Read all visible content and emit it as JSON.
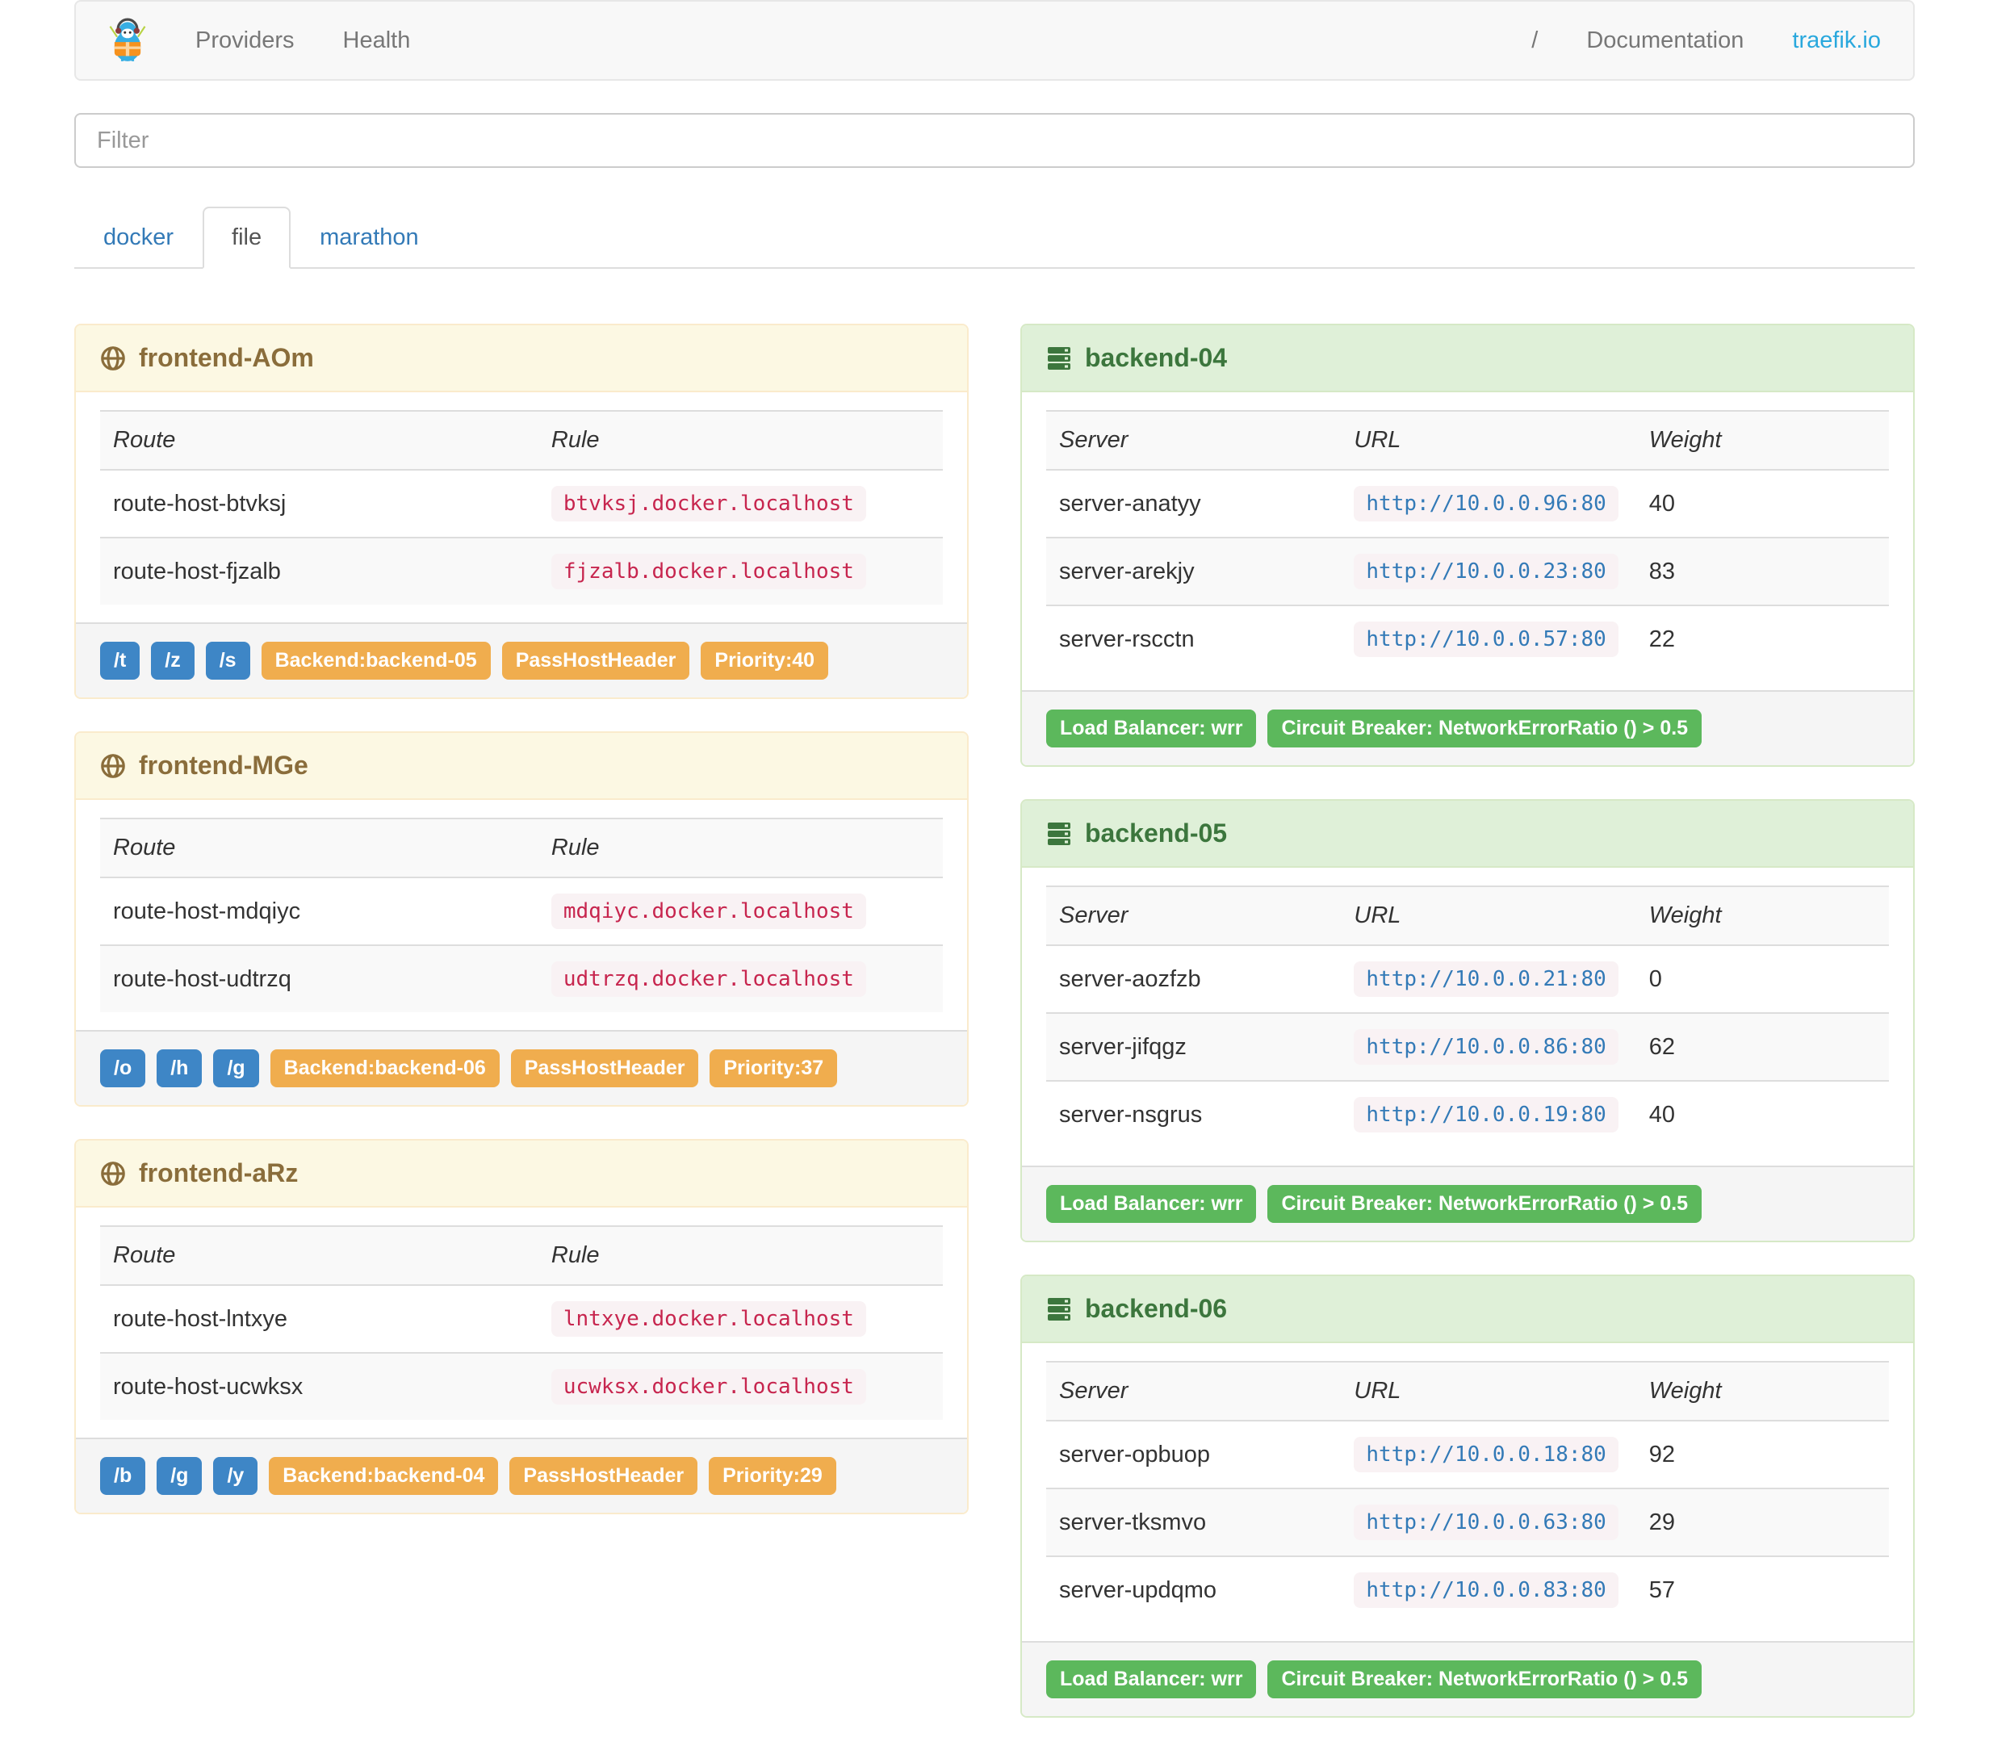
{
  "navbar": {
    "brand": "traefik",
    "providers_label": "Providers",
    "health_label": "Health",
    "root_label": "/",
    "documentation_label": "Documentation",
    "site_label": "traefik.io"
  },
  "filter": {
    "placeholder": "Filter",
    "value": ""
  },
  "tabs": [
    {
      "label": "docker",
      "active": false
    },
    {
      "label": "file",
      "active": true
    },
    {
      "label": "marathon",
      "active": false
    }
  ],
  "frontends": [
    {
      "name": "frontend-AOm",
      "columns": [
        "Route",
        "Rule"
      ],
      "routes": [
        {
          "route": "route-host-btvksj",
          "rule": "btvksj.docker.localhost"
        },
        {
          "route": "route-host-fjzalb",
          "rule": "fjzalb.docker.localhost"
        }
      ],
      "paths": [
        "/t",
        "/z",
        "/s"
      ],
      "tags": [
        "Backend:backend-05",
        "PassHostHeader",
        "Priority:40"
      ]
    },
    {
      "name": "frontend-MGe",
      "columns": [
        "Route",
        "Rule"
      ],
      "routes": [
        {
          "route": "route-host-mdqiyc",
          "rule": "mdqiyc.docker.localhost"
        },
        {
          "route": "route-host-udtrzq",
          "rule": "udtrzq.docker.localhost"
        }
      ],
      "paths": [
        "/o",
        "/h",
        "/g"
      ],
      "tags": [
        "Backend:backend-06",
        "PassHostHeader",
        "Priority:37"
      ]
    },
    {
      "name": "frontend-aRz",
      "columns": [
        "Route",
        "Rule"
      ],
      "routes": [
        {
          "route": "route-host-lntxye",
          "rule": "lntxye.docker.localhost"
        },
        {
          "route": "route-host-ucwksx",
          "rule": "ucwksx.docker.localhost"
        }
      ],
      "paths": [
        "/b",
        "/g",
        "/y"
      ],
      "tags": [
        "Backend:backend-04",
        "PassHostHeader",
        "Priority:29"
      ]
    }
  ],
  "backends": [
    {
      "name": "backend-04",
      "columns": [
        "Server",
        "URL",
        "Weight"
      ],
      "servers": [
        {
          "server": "server-anatyy",
          "url": "http://10.0.0.96:80",
          "weight": "40"
        },
        {
          "server": "server-arekjy",
          "url": "http://10.0.0.23:80",
          "weight": "83"
        },
        {
          "server": "server-rscctn",
          "url": "http://10.0.0.57:80",
          "weight": "22"
        }
      ],
      "tags": [
        "Load Balancer: wrr",
        "Circuit Breaker: NetworkErrorRatio () > 0.5"
      ]
    },
    {
      "name": "backend-05",
      "columns": [
        "Server",
        "URL",
        "Weight"
      ],
      "servers": [
        {
          "server": "server-aozfzb",
          "url": "http://10.0.0.21:80",
          "weight": "0"
        },
        {
          "server": "server-jifqgz",
          "url": "http://10.0.0.86:80",
          "weight": "62"
        },
        {
          "server": "server-nsgrus",
          "url": "http://10.0.0.19:80",
          "weight": "40"
        }
      ],
      "tags": [
        "Load Balancer: wrr",
        "Circuit Breaker: NetworkErrorRatio () > 0.5"
      ]
    },
    {
      "name": "backend-06",
      "columns": [
        "Server",
        "URL",
        "Weight"
      ],
      "servers": [
        {
          "server": "server-opbuop",
          "url": "http://10.0.0.18:80",
          "weight": "92"
        },
        {
          "server": "server-tksmvo",
          "url": "http://10.0.0.63:80",
          "weight": "29"
        },
        {
          "server": "server-updqmo",
          "url": "http://10.0.0.83:80",
          "weight": "57"
        }
      ],
      "tags": [
        "Load Balancer: wrr",
        "Circuit Breaker: NetworkErrorRatio () > 0.5"
      ]
    }
  ],
  "colors": {
    "frontend_header_bg": "#fcf8e3",
    "frontend_header_text": "#8a6d3b",
    "backend_header_bg": "#dff0d8",
    "backend_header_text": "#3c763d",
    "label_blue": "#3e86c6",
    "label_orange": "#f0ad4e",
    "label_green": "#5cb85c",
    "code_pink_bg": "#f9f2f4",
    "code_red_text": "#c7254e",
    "link_blue": "#337ab7",
    "site_link_blue": "#29a8dd"
  }
}
